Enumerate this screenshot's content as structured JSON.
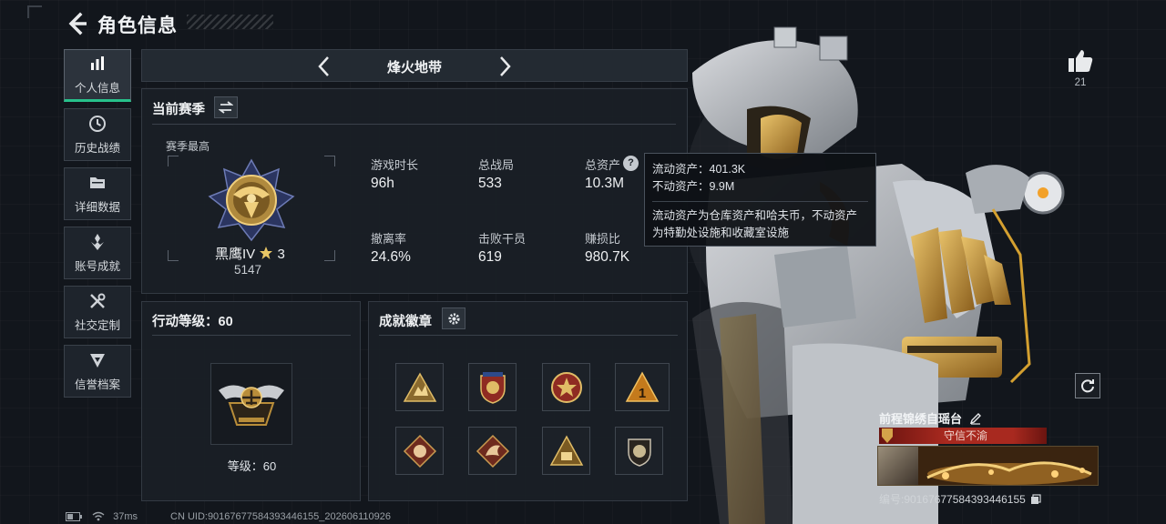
{
  "header": {
    "title": "角色信息"
  },
  "sidebar": {
    "items": [
      {
        "label": "个人信息",
        "icon": "bar-chart-icon",
        "active": true
      },
      {
        "label": "历史战绩",
        "icon": "history-icon",
        "active": false
      },
      {
        "label": "详细数据",
        "icon": "folder-icon",
        "active": false
      },
      {
        "label": "账号成就",
        "icon": "achievement-icon",
        "active": false
      },
      {
        "label": "社交定制",
        "icon": "tools-icon",
        "active": false
      },
      {
        "label": "信誉档案",
        "icon": "credit-icon",
        "active": false
      }
    ]
  },
  "mode_selector": {
    "current": "烽火地带"
  },
  "season": {
    "title": "当前赛季",
    "best_label": "赛季最高",
    "rank_name": "黑鹰IV",
    "rank_stars": "3",
    "rank_score": "5147",
    "stats": [
      {
        "label": "游戏时长",
        "value": "96h"
      },
      {
        "label": "总战局",
        "value": "533"
      },
      {
        "label": "总资产",
        "value": "10.3M"
      },
      {
        "label": "撤离率",
        "value": "24.6%"
      },
      {
        "label": "击败干员",
        "value": "619"
      },
      {
        "label": "赚损比",
        "value": "980.7K"
      }
    ]
  },
  "tooltip": {
    "liquid": "流动资产：401.3K",
    "fixed": "不动资产：9.9M",
    "desc_line1": "流动资产为仓库资产和哈夫币，不动资产",
    "desc_line2": "为特勤处设施和收藏室设施"
  },
  "level": {
    "title": "行动等级：60",
    "label": "等级：60"
  },
  "badges": {
    "title": "成就徽章"
  },
  "social": {
    "likes": "21"
  },
  "card": {
    "name": "前程锦绣自瑶台",
    "tag": "守信不渝",
    "id": "编号:9016767758439344615​5"
  },
  "status": {
    "ping": "37ms",
    "uid": "CN UID:9016767758439344615​5_202606110926"
  },
  "colors": {
    "accent": "#27c18b",
    "gold": "#c9a24a",
    "tag_red": "#a8291f"
  }
}
